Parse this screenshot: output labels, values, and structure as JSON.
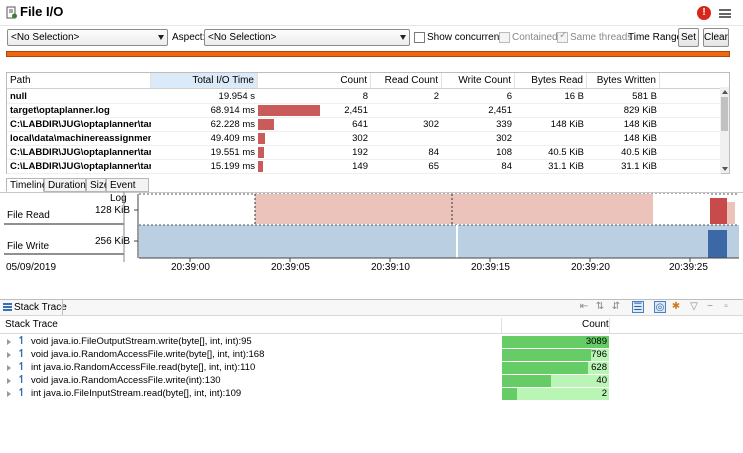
{
  "window": {
    "title": "File I/O"
  },
  "filters": {
    "path_select": "<No Selection>",
    "aspect_label": "Aspect:",
    "aspect_select": "<No Selection>",
    "show_concurrent_label": "Show concurrent:",
    "contained_label": "Contained",
    "same_threads_label": "Same threads",
    "time_range_label": "Time Range:",
    "set_label": "Set",
    "clear_label": "Clear"
  },
  "table": {
    "columns": [
      "Path",
      "Total I/O Time",
      "Count",
      "Read Count",
      "Write Count",
      "Bytes Read",
      "Bytes Written"
    ],
    "rows": [
      {
        "path": "null",
        "time": "19.954 s",
        "count": "8",
        "read_count": "2",
        "write_count": "6",
        "bytes_read": "16 B",
        "bytes_written": "581 B",
        "bar_fraction": 0.0
      },
      {
        "path": "target\\optaplanner.log",
        "time": "68.914 ms",
        "count": "2,451",
        "read_count": "",
        "write_count": "2,451",
        "bytes_read": "",
        "bytes_written": "829 KiB",
        "bar_fraction": 0.55
      },
      {
        "path": "C:\\LABDIR\\JUG\\optaplanner\\tar...",
        "time": "62.228 ms",
        "count": "641",
        "read_count": "302",
        "write_count": "339",
        "bytes_read": "148 KiB",
        "bytes_written": "148 KiB",
        "bar_fraction": 0.14
      },
      {
        "path": "local\\data\\machinereassignment...",
        "time": "49.409 ms",
        "count": "302",
        "read_count": "",
        "write_count": "302",
        "bytes_read": "",
        "bytes_written": "148 KiB",
        "bar_fraction": 0.06
      },
      {
        "path": "C:\\LABDIR\\JUG\\optaplanner\\tar...",
        "time": "19.551 ms",
        "count": "192",
        "read_count": "84",
        "write_count": "108",
        "bytes_read": "40.5 KiB",
        "bytes_written": "40.5 KiB",
        "bar_fraction": 0.05
      },
      {
        "path": "C:\\LABDIR\\JUG\\optaplanner\\tar...",
        "time": "15.199 ms",
        "count": "149",
        "read_count": "65",
        "write_count": "84",
        "bytes_read": "31.1 KiB",
        "bytes_written": "31.1 KiB",
        "bar_fraction": 0.04
      }
    ]
  },
  "tabs": [
    "Timeline",
    "Durations",
    "Size",
    "Event Log"
  ],
  "timeline": {
    "lanes": [
      {
        "name": "File Read",
        "max": "128 KiB",
        "color": "#ecc3ba"
      },
      {
        "name": "File Write",
        "max": "256 KiB",
        "color": "#bacfe2"
      }
    ],
    "date": "05/09/2019",
    "ticks": [
      "20:39:00",
      "20:39:05",
      "20:39:10",
      "20:39:15",
      "20:39:20",
      "20:39:25"
    ]
  },
  "stack_trace": {
    "title": "Stack Trace",
    "col_trace": "Stack Trace",
    "col_count": "Count",
    "max_count": 3089,
    "rows": [
      {
        "frame": "void java.io.FileOutputStream.write(byte[], int, int):95",
        "count": 3089
      },
      {
        "frame": "void java.io.RandomAccessFile.write(byte[], int, int):168",
        "count": 796
      },
      {
        "frame": "int java.io.RandomAccessFile.read(byte[], int, int):110",
        "count": 628
      },
      {
        "frame": "void java.io.RandomAccessFile.write(int):130",
        "count": 40
      },
      {
        "frame": "int java.io.FileInputStream.read(byte[], int, int):109",
        "count": 2
      }
    ]
  },
  "colors": {
    "accent_orange": "#ef6512",
    "io_bar": "#c95b5b",
    "count_bar": "#66cc66"
  }
}
